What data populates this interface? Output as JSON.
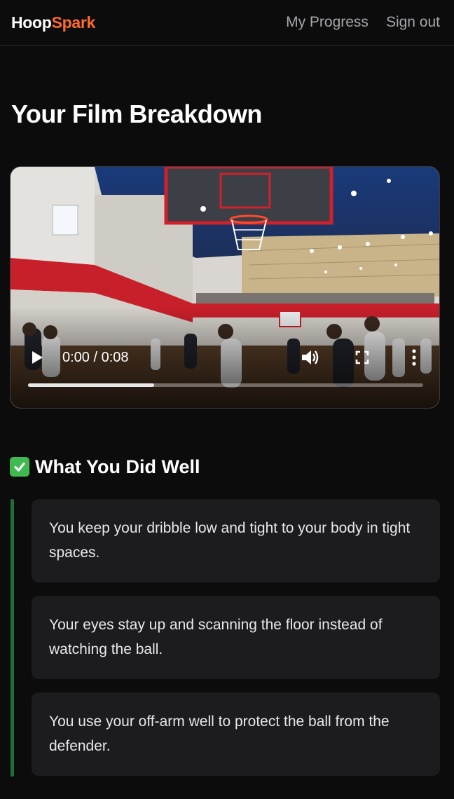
{
  "header": {
    "brand_part1": "Hoop",
    "brand_part2": "Spark",
    "nav": [
      {
        "label": "My Progress"
      },
      {
        "label": "Sign out"
      }
    ]
  },
  "page": {
    "title": "Your Film Breakdown"
  },
  "video": {
    "time_display": "0:00 / 0:08",
    "buffered_fraction": 0.32
  },
  "strengths": {
    "heading": "What You Did Well",
    "items": [
      {
        "text": "You keep your dribble low and tight to your body in tight spaces."
      },
      {
        "text": "Your eyes stay up and scanning the floor instead of watching the ball."
      },
      {
        "text": "You use your off-arm well to protect the ball from the defender."
      }
    ]
  },
  "colors": {
    "brand_accent": "#ff6a2b",
    "success_green": "#3fb950",
    "accent_bar": "#1f6f35"
  }
}
